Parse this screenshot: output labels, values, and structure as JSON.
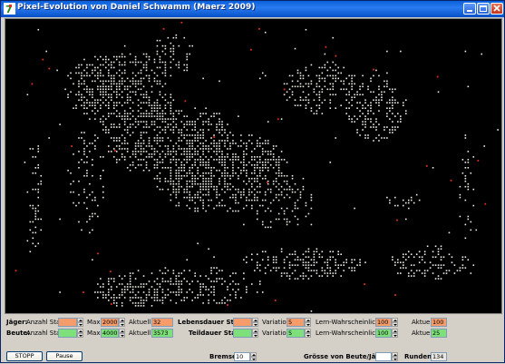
{
  "window": {
    "title": "Pixel-Evolution von Daniel Schwamm (Maerz 2009)",
    "icon": "app-logo-icon"
  },
  "titlebar_buttons": [
    "minimize-icon",
    "maximize-icon",
    "close-icon"
  ],
  "colors": {
    "prey": "#f0f0e8",
    "hunter": "#e03020",
    "background": "#000000",
    "field_orange": "#f59c6a",
    "field_green": "#7ee07a"
  },
  "row_jaeger": {
    "label": "Jäger:",
    "anzahl_start_label": "Anzahl Start:",
    "anzahl_start": "",
    "max_label": "Max:",
    "max": "2000",
    "aktuell_label": "Aktuell:",
    "aktuell": "32",
    "lebensdauer_label": "Lebensdauer Start:",
    "lebensdauer": "",
    "variation_label": "Variation:",
    "variation": "5",
    "lern_label": "Lern-Wahrscheinlichkeit:",
    "lern": "100",
    "lern_aktuell_label": "Aktuell:",
    "lern_aktuell": "100"
  },
  "row_beute": {
    "label": "Beute:",
    "anzahl_start_label": "Anzahl Start:",
    "anzahl_start": "",
    "max_label": "Max:",
    "max": "4000",
    "aktuell_label": "Aktuell:",
    "aktuell": "3573",
    "teildauer_label": "Teildauer Start:",
    "teildauer": "",
    "variation_label": "Variation:",
    "variation": "5",
    "lern_label": "Lern-Wahrscheinlichkeit:",
    "lern": "100",
    "lern_aktuell_label": "Aktuell:",
    "lern_aktuell": "25"
  },
  "row_bottom": {
    "stopp_label": "STOPP",
    "pause_label": "Pause",
    "bremse_label": "Bremse:",
    "bremse": "10",
    "groesse_label": "Grösse von Beute/Jäger:",
    "groesse": "",
    "runden_label": "Runden:",
    "runden": "134"
  }
}
